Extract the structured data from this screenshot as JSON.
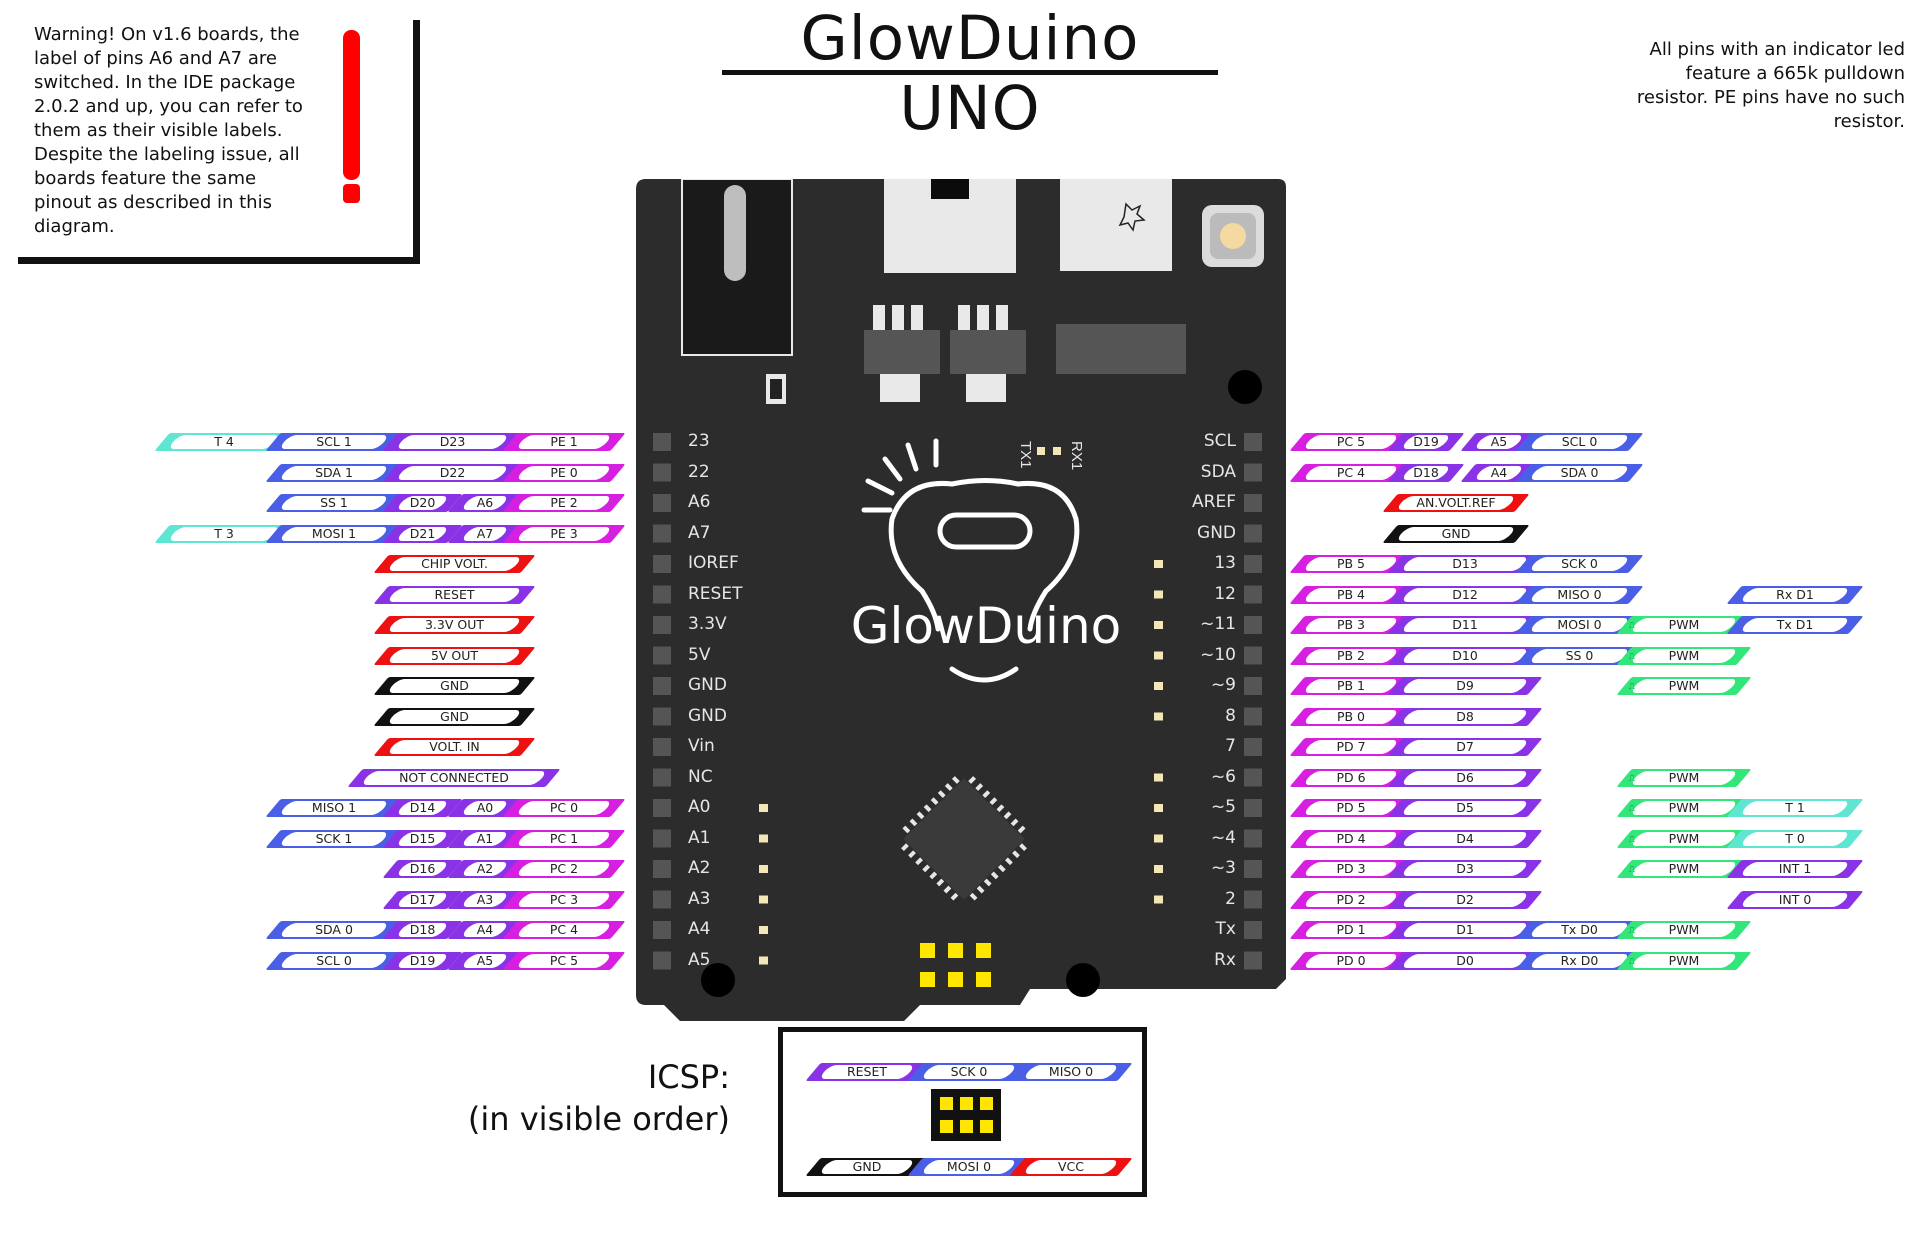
{
  "title": "GlowDuino UNO",
  "warning": "Warning! On v1.6 boards, the\nlabel of pins A6 and A7 are\nswitched. In the IDE package\n2.0.2 and up, you can refer to\nthem as their visible labels.\nDespite the labeling issue, all\nboards feature the same\npinout as described in this\ndiagram.",
  "note": "All pins with an indicator led\nfeature a 665k pulldown\nresistor. PE pins have no such\nresistor.",
  "board": {
    "logo_text": "GlowDuino",
    "tx_label": "TX1",
    "rx_label": "RX1",
    "left_pins": [
      "23",
      "22",
      "A6",
      "A7",
      "IOREF",
      "RESET",
      "3.3V",
      "5V",
      "GND",
      "GND",
      "Vin",
      "NC",
      "A0",
      "A1",
      "A2",
      "A3",
      "A4",
      "A5"
    ],
    "right_pins": [
      "SCL",
      "SDA",
      "AREF",
      "GND",
      "13",
      "12",
      "~11",
      "~10",
      "~9",
      "8",
      "7",
      "~6",
      "~5",
      "~4",
      "~3",
      "2",
      "Tx",
      "Rx"
    ]
  },
  "colors": {
    "teal": "#5ee6d2",
    "blue": "#4a5ee6",
    "purple": "#8a33e6",
    "magenta": "#d61fe0",
    "red": "#ee1111",
    "black": "#111111",
    "green": "#33e67a",
    "board": "#2c2c2c"
  },
  "left_labels": [
    [
      {
        "t": "T 4",
        "c": "teal"
      },
      {
        "t": "SCL 1",
        "c": "blue"
      },
      {
        "t": "D23",
        "c": "purple"
      },
      {
        "t": "PE 1",
        "c": "magenta"
      }
    ],
    [
      {
        "t": "SDA 1",
        "c": "blue"
      },
      {
        "t": "D22",
        "c": "purple"
      },
      {
        "t": "PE 0",
        "c": "magenta"
      }
    ],
    [
      {
        "t": "SS 1",
        "c": "blue"
      },
      {
        "t": "D20",
        "c": "purple"
      },
      {
        "t": "A6",
        "c": "purple"
      },
      {
        "t": "PE 2",
        "c": "magenta"
      }
    ],
    [
      {
        "t": "T 3",
        "c": "teal"
      },
      {
        "t": "MOSI 1",
        "c": "blue"
      },
      {
        "t": "D21",
        "c": "purple"
      },
      {
        "t": "A7",
        "c": "purple"
      },
      {
        "t": "PE 3",
        "c": "magenta"
      }
    ],
    [
      {
        "t": "CHIP VOLT.",
        "c": "red"
      }
    ],
    [
      {
        "t": "RESET",
        "c": "purple"
      }
    ],
    [
      {
        "t": "3.3V OUT",
        "c": "red"
      }
    ],
    [
      {
        "t": "5V OUT",
        "c": "red"
      }
    ],
    [
      {
        "t": "GND",
        "c": "black"
      }
    ],
    [
      {
        "t": "GND",
        "c": "black"
      }
    ],
    [
      {
        "t": "VOLT. IN",
        "c": "red"
      }
    ],
    [
      {
        "t": "NOT CONNECTED",
        "c": "purple"
      }
    ],
    [
      {
        "t": "MISO 1",
        "c": "blue"
      },
      {
        "t": "D14",
        "c": "purple"
      },
      {
        "t": "A0",
        "c": "purple"
      },
      {
        "t": "PC 0",
        "c": "magenta"
      }
    ],
    [
      {
        "t": "SCK 1",
        "c": "blue"
      },
      {
        "t": "D15",
        "c": "purple"
      },
      {
        "t": "A1",
        "c": "purple"
      },
      {
        "t": "PC 1",
        "c": "magenta"
      }
    ],
    [
      {
        "t": "D16",
        "c": "purple"
      },
      {
        "t": "A2",
        "c": "purple"
      },
      {
        "t": "PC 2",
        "c": "magenta"
      }
    ],
    [
      {
        "t": "D17",
        "c": "purple"
      },
      {
        "t": "A3",
        "c": "purple"
      },
      {
        "t": "PC 3",
        "c": "magenta"
      }
    ],
    [
      {
        "t": "SDA 0",
        "c": "blue"
      },
      {
        "t": "D18",
        "c": "purple"
      },
      {
        "t": "A4",
        "c": "purple"
      },
      {
        "t": "PC 4",
        "c": "magenta"
      }
    ],
    [
      {
        "t": "SCL 0",
        "c": "blue"
      },
      {
        "t": "D19",
        "c": "purple"
      },
      {
        "t": "A5",
        "c": "purple"
      },
      {
        "t": "PC 5",
        "c": "magenta"
      }
    ]
  ],
  "right_labels": [
    [
      {
        "t": "PC 5",
        "c": "magenta"
      },
      {
        "t": "D19",
        "c": "purple"
      },
      {
        "t": "A5",
        "c": "purple"
      },
      {
        "t": "SCL 0",
        "c": "blue"
      }
    ],
    [
      {
        "t": "PC 4",
        "c": "magenta"
      },
      {
        "t": "D18",
        "c": "purple"
      },
      {
        "t": "A4",
        "c": "purple"
      },
      {
        "t": "SDA 0",
        "c": "blue"
      }
    ],
    [
      {
        "t": "AN.VOLT.REF",
        "c": "red"
      }
    ],
    [
      {
        "t": "GND",
        "c": "black"
      }
    ],
    [
      {
        "t": "PB 5",
        "c": "magenta"
      },
      {
        "t": "D13",
        "c": "purple"
      },
      {
        "t": "SCK 0",
        "c": "blue"
      }
    ],
    [
      {
        "t": "PB 4",
        "c": "magenta"
      },
      {
        "t": "D12",
        "c": "purple"
      },
      {
        "t": "MISO 0",
        "c": "blue"
      },
      {
        "t": "Rx D1",
        "c": "blue"
      }
    ],
    [
      {
        "t": "PB 3",
        "c": "magenta"
      },
      {
        "t": "D11",
        "c": "purple"
      },
      {
        "t": "MOSI 0",
        "c": "blue"
      },
      {
        "t": "PWM",
        "c": "green"
      },
      {
        "t": "Tx D1",
        "c": "blue"
      }
    ],
    [
      {
        "t": "PB 2",
        "c": "magenta"
      },
      {
        "t": "D10",
        "c": "purple"
      },
      {
        "t": "SS 0",
        "c": "blue"
      },
      {
        "t": "PWM",
        "c": "green"
      }
    ],
    [
      {
        "t": "PB 1",
        "c": "magenta"
      },
      {
        "t": "D9",
        "c": "purple"
      },
      {
        "t": "PWM",
        "c": "green"
      }
    ],
    [
      {
        "t": "PB 0",
        "c": "magenta"
      },
      {
        "t": "D8",
        "c": "purple"
      }
    ],
    [
      {
        "t": "PD 7",
        "c": "magenta"
      },
      {
        "t": "D7",
        "c": "purple"
      }
    ],
    [
      {
        "t": "PD 6",
        "c": "magenta"
      },
      {
        "t": "D6",
        "c": "purple"
      },
      {
        "t": "PWM",
        "c": "green"
      }
    ],
    [
      {
        "t": "PD 5",
        "c": "magenta"
      },
      {
        "t": "D5",
        "c": "purple"
      },
      {
        "t": "PWM",
        "c": "green"
      },
      {
        "t": "T 1",
        "c": "teal"
      }
    ],
    [
      {
        "t": "PD 4",
        "c": "magenta"
      },
      {
        "t": "D4",
        "c": "purple"
      },
      {
        "t": "PWM",
        "c": "green"
      },
      {
        "t": "T 0",
        "c": "teal"
      }
    ],
    [
      {
        "t": "PD 3",
        "c": "magenta"
      },
      {
        "t": "D3",
        "c": "purple"
      },
      {
        "t": "PWM",
        "c": "green"
      },
      {
        "t": "INT 1",
        "c": "purple"
      }
    ],
    [
      {
        "t": "PD 2",
        "c": "magenta"
      },
      {
        "t": "D2",
        "c": "purple"
      },
      {
        "t": "INT 0",
        "c": "purple"
      }
    ],
    [
      {
        "t": "PD 1",
        "c": "magenta"
      },
      {
        "t": "D1",
        "c": "purple"
      },
      {
        "t": "Tx D0",
        "c": "blue"
      },
      {
        "t": "PWM",
        "c": "green"
      }
    ],
    [
      {
        "t": "PD 0",
        "c": "magenta"
      },
      {
        "t": "D0",
        "c": "purple"
      },
      {
        "t": "Rx D0",
        "c": "blue"
      },
      {
        "t": "PWM",
        "c": "green"
      }
    ]
  ],
  "icsp": {
    "title": "ICSP:\n(in visible order)",
    "top": [
      {
        "t": "RESET",
        "c": "purple"
      },
      {
        "t": "SCK 0",
        "c": "blue"
      },
      {
        "t": "MISO 0",
        "c": "blue"
      }
    ],
    "bottom": [
      {
        "t": "GND",
        "c": "black"
      },
      {
        "t": "MOSI 0",
        "c": "blue"
      },
      {
        "t": "VCC",
        "c": "red"
      }
    ]
  }
}
